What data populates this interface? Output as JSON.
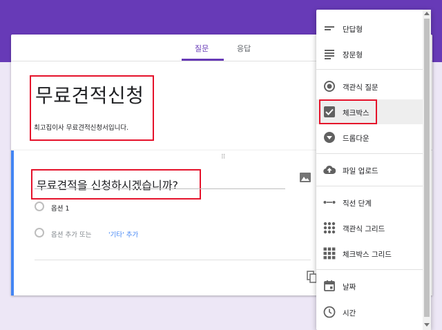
{
  "colors": {
    "accent": "#673ab7",
    "highlight": "#e5112a",
    "active_border": "#4285f4"
  },
  "tabs": [
    {
      "label": "질문",
      "active": true
    },
    {
      "label": "응답",
      "active": false
    }
  ],
  "form": {
    "title": "무료견적신청",
    "description": "최고집이사 무료견적신청서입니다."
  },
  "question": {
    "title": "무료견적을 신청하시겠습니까?",
    "option1": "옵션 1",
    "add_option": "옵션 추가 또는",
    "add_other": "'기타' 추가"
  },
  "menu": {
    "items": [
      {
        "label": "단답형",
        "icon": "short-answer-icon"
      },
      {
        "label": "장문형",
        "icon": "paragraph-icon"
      },
      {
        "label": "객관식 질문",
        "icon": "radio-icon"
      },
      {
        "label": "체크박스",
        "icon": "checkbox-icon",
        "selected": true
      },
      {
        "label": "드롭다운",
        "icon": "dropdown-icon"
      },
      {
        "label": "파일 업로드",
        "icon": "upload-icon"
      },
      {
        "label": "직선 단계",
        "icon": "linear-scale-icon"
      },
      {
        "label": "객관식 그리드",
        "icon": "radio-grid-icon"
      },
      {
        "label": "체크박스 그리드",
        "icon": "checkbox-grid-icon"
      },
      {
        "label": "날짜",
        "icon": "calendar-icon"
      },
      {
        "label": "시간",
        "icon": "clock-icon"
      }
    ]
  }
}
